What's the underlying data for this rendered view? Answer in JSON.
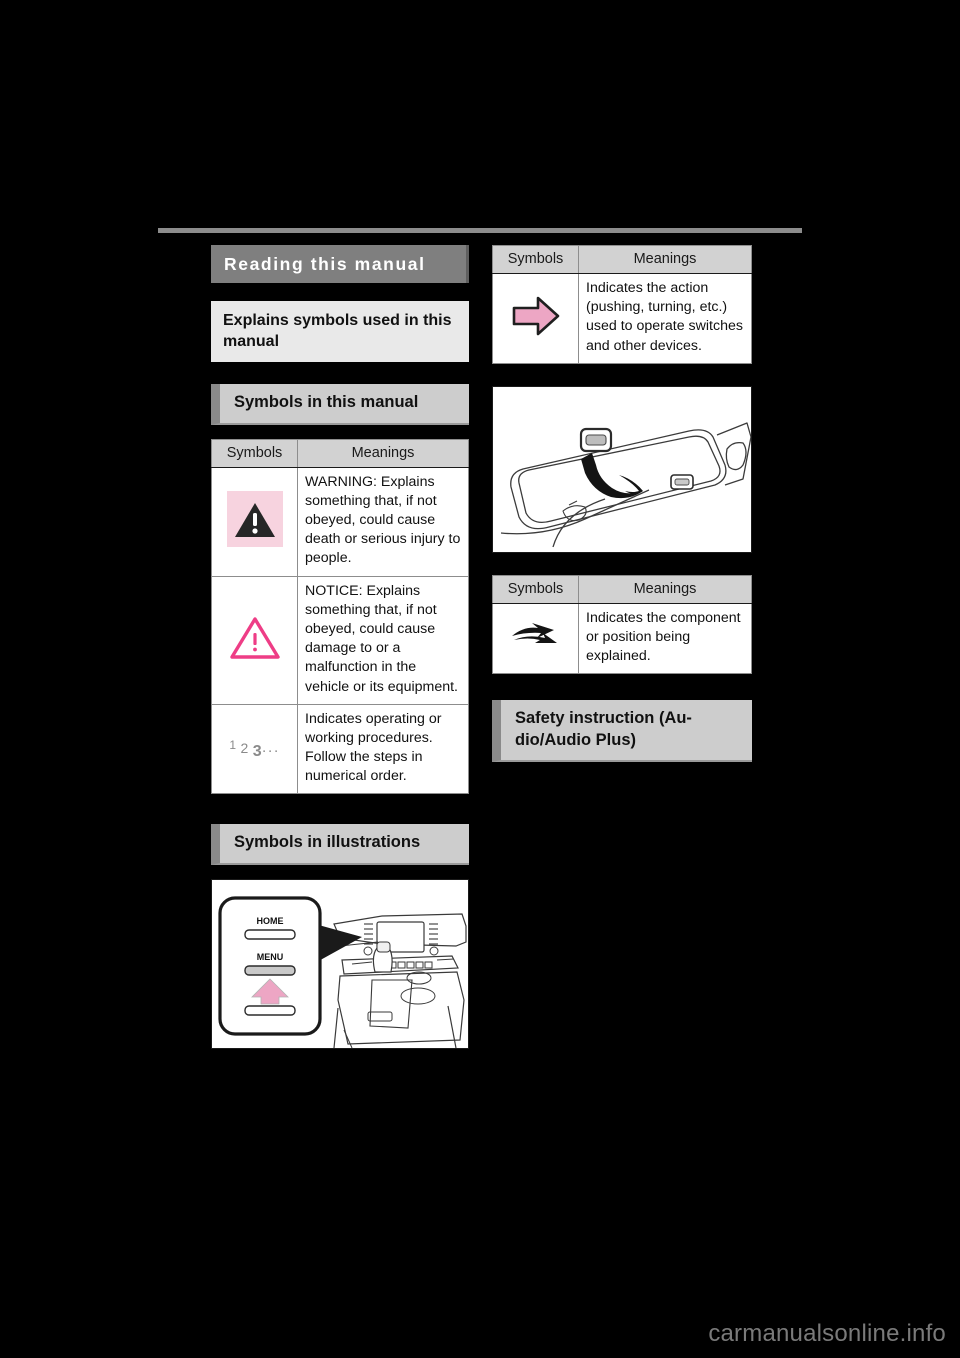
{
  "page": {
    "background_color": "#000000",
    "watermark": "carmanualsonline.info"
  },
  "left_column": {
    "section_title": "Reading this manual",
    "subsection_title": "Explains symbols used in this manual",
    "heading_symbols_in_manual": "Symbols in this manual",
    "heading_symbols_in_illustrations": "Symbols in illustrations",
    "table": {
      "headers": [
        "Symbols",
        "Meanings"
      ],
      "rows": [
        {
          "symbol": "warning-triangle-icon",
          "meaning": "WARNING: Explains something that, if not obeyed, could cause death or serious injury to people."
        },
        {
          "symbol": "notice-triangle-icon",
          "meaning": "NOTICE: Explains something that, if not obeyed, could cause damage to or a malfunction in the vehicle or its equipment."
        },
        {
          "symbol": "numbered-steps-icon",
          "symbol_text": "1 2 3 ···",
          "meaning": "Indicates operating or working procedures. Follow the steps in numerical order."
        }
      ]
    },
    "illustration": {
      "name": "dashboard-callout-illustration",
      "labels": [
        "HOME",
        "MENU"
      ]
    }
  },
  "right_column": {
    "table_action": {
      "headers": [
        "Symbols",
        "Meanings"
      ],
      "rows": [
        {
          "symbol": "pink-block-arrow-icon",
          "meaning": "Indicates the action (pushing, turning, etc.) used to operate switches and other devices."
        }
      ]
    },
    "illustration": {
      "name": "headliner-switch-illustration"
    },
    "table_component": {
      "headers": [
        "Symbols",
        "Meanings"
      ],
      "rows": [
        {
          "symbol": "black-swoosh-arrow-icon",
          "meaning": "Indicates the component or position being explained."
        }
      ]
    },
    "heading_safety": "Safety instruction (Au-dio/Audio Plus)"
  },
  "colors": {
    "section_bar": "#7f7f7f",
    "subsection_bg": "#e9e9e9",
    "heading_bg": "#cdcdcd",
    "heading_accent": "#8a8a8a",
    "table_header_bg": "#d2d2d2",
    "warning_bg": "#f7d3df",
    "notice_pink": "#ee3d86",
    "action_arrow_pink": "#eda6c4"
  }
}
